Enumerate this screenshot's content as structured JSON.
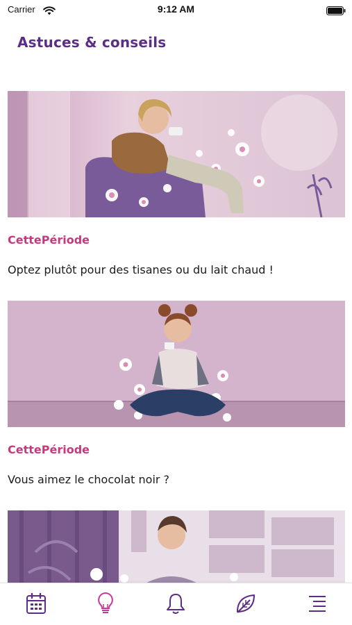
{
  "status_bar": {
    "carrier": "Carrier",
    "time": "9:12 AM"
  },
  "header": {
    "title": "Astuces & conseils"
  },
  "feed": {
    "items": [
      {
        "category": "CettePériode",
        "text": "Optez plutôt pour des tisanes ou du lait chaud !",
        "image": "woman-drinking-tea-illustration"
      },
      {
        "category": "CettePériode",
        "text": "Vous aimez le chocolat noir ?",
        "image": "woman-eating-chocolate-illustration"
      },
      {
        "category": "",
        "text": "",
        "image": "woman-meditating-illustration"
      }
    ]
  },
  "tab_bar": {
    "tabs": [
      {
        "name": "calendar",
        "icon": "calendar-icon",
        "active": false
      },
      {
        "name": "tips",
        "icon": "lightbulb-icon",
        "active": true
      },
      {
        "name": "notifications",
        "icon": "bell-icon",
        "active": false
      },
      {
        "name": "wellness",
        "icon": "leaf-icon",
        "active": false
      },
      {
        "name": "menu",
        "icon": "menu-icon",
        "active": false
      }
    ]
  },
  "colors": {
    "title": "#5b2d86",
    "category": "#c53a7e",
    "tab_inactive": "#5b2d86",
    "tab_active": "#c53a9a"
  }
}
